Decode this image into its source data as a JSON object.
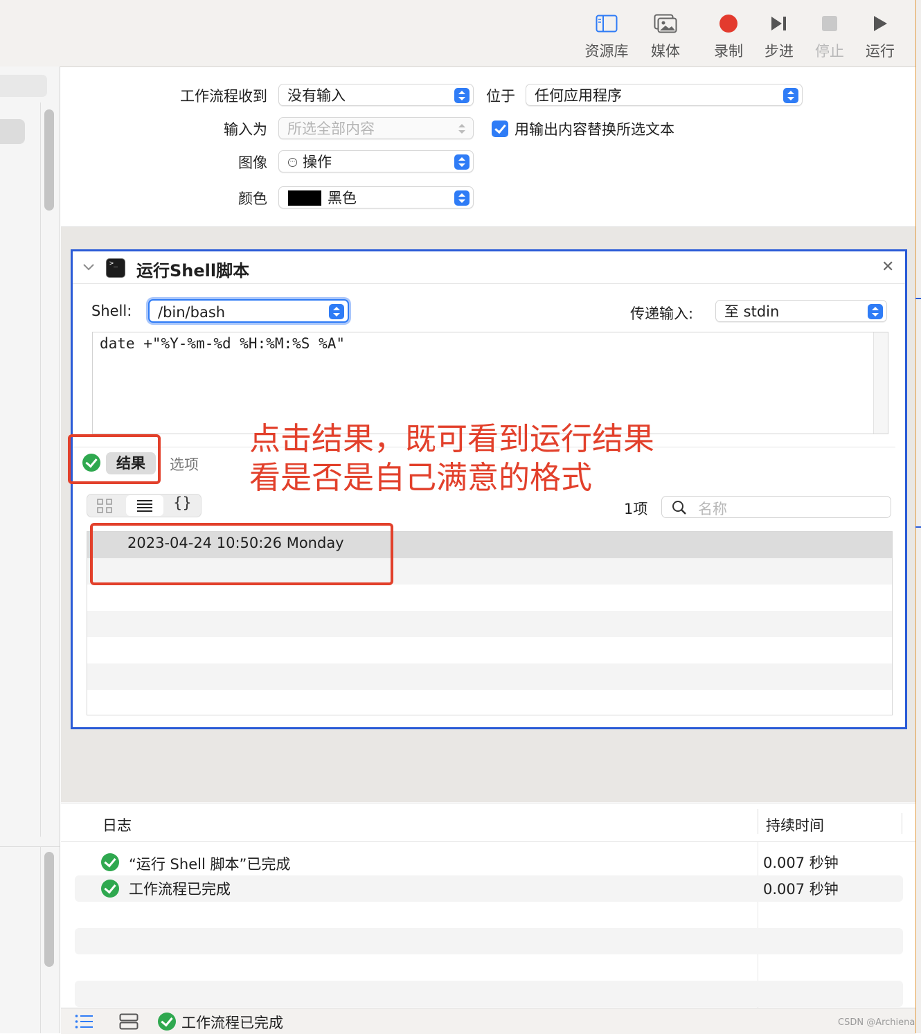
{
  "toolbar": {
    "library": "资源库",
    "media": "媒体",
    "record": "录制",
    "step": "步进",
    "stop": "停止",
    "run": "运行"
  },
  "params": {
    "receives_label": "工作流程收到",
    "receives_value": "没有输入",
    "in_label": "位于",
    "in_value": "任何应用程序",
    "input_is_label": "输入为",
    "input_is_value": "所选全部内容",
    "replace_label": "用输出内容替换所选文本",
    "image_label": "图像",
    "image_value": "操作",
    "color_label": "颜色",
    "color_value": "黑色"
  },
  "action": {
    "title": "运行Shell脚本",
    "shell_label": "Shell:",
    "shell_value": "/bin/bash",
    "pass_label": "传递输入:",
    "pass_value": "至 stdin",
    "script": "date +\"%Y-%m-%d %H:%M:%S %A\"",
    "tab_results": "结果",
    "tab_options": "选项",
    "count": "1项",
    "search_placeholder": "名称",
    "result_row": "2023-04-24 10:50:26 Monday"
  },
  "annotation": {
    "line1": "点击结果，既可看到运行结果",
    "line2": "看是否是自己满意的格式"
  },
  "log": {
    "col_log": "日志",
    "col_duration": "持续时间",
    "rows": [
      {
        "text": "“运行 Shell 脚本”已完成",
        "duration": "0.007 秒钟"
      },
      {
        "text": "工作流程已完成",
        "duration": "0.007 秒钟"
      }
    ]
  },
  "status": {
    "text": "工作流程已完成"
  },
  "watermark": "CSDN @Archiena",
  "colors": {
    "accent": "#2f7cf6",
    "annotation": "#e2402b",
    "action_border": "#2a5bd7",
    "success": "#2fa84f",
    "record": "#e33b2e"
  }
}
